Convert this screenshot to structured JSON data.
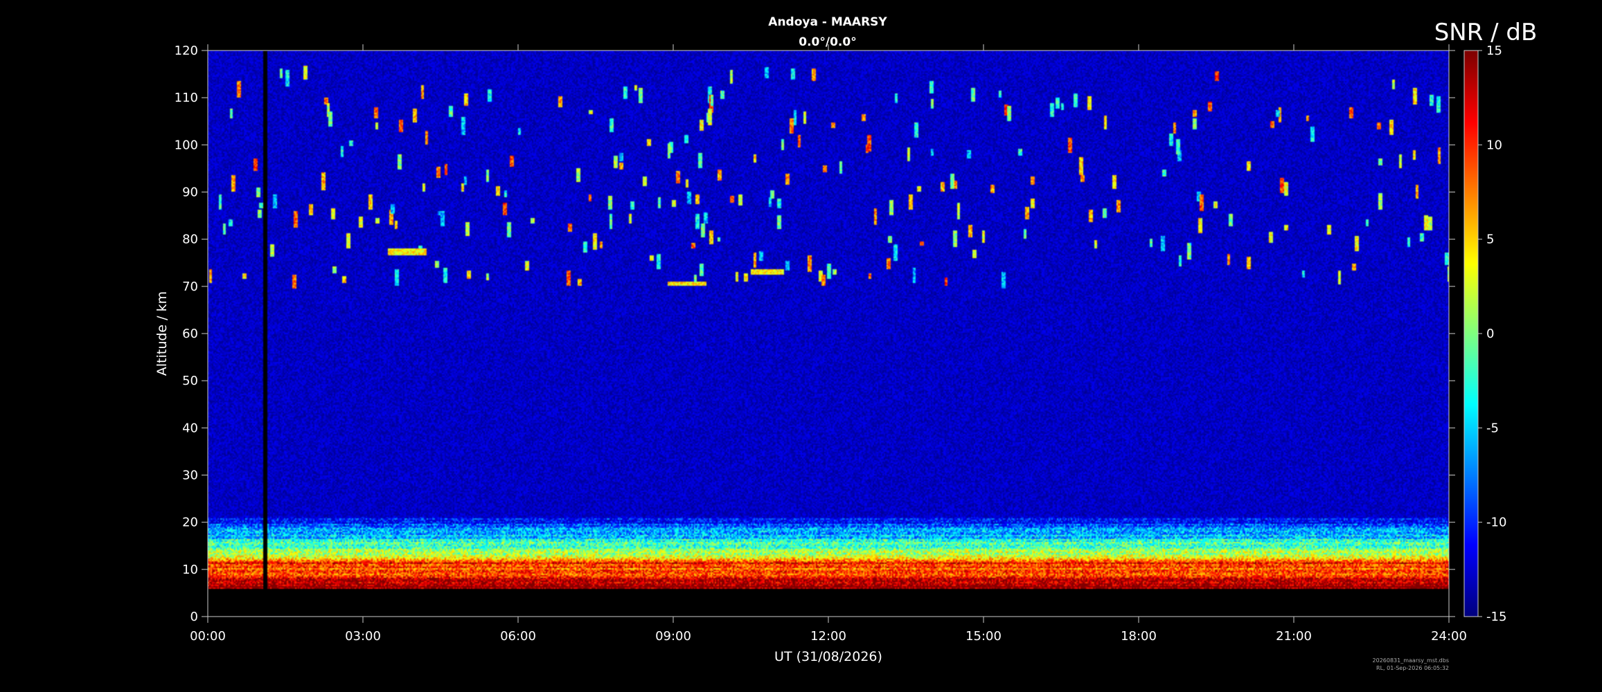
{
  "chart_data": {
    "type": "heatmap",
    "title": "Andoya - MAARSY",
    "subtitle": "0.0°/0.0°",
    "xlabel": "UT (31/08/2026)",
    "ylabel": "Altitude / km",
    "xlim": [
      0,
      24
    ],
    "ylim": [
      0,
      120
    ],
    "x_ticks": [
      {
        "value": 0,
        "label": "00:00"
      },
      {
        "value": 3,
        "label": "03:00"
      },
      {
        "value": 6,
        "label": "06:00"
      },
      {
        "value": 9,
        "label": "09:00"
      },
      {
        "value": 12,
        "label": "12:00"
      },
      {
        "value": 15,
        "label": "15:00"
      },
      {
        "value": 18,
        "label": "18:00"
      },
      {
        "value": 21,
        "label": "21:00"
      },
      {
        "value": 24,
        "label": "24:00"
      }
    ],
    "y_ticks": [
      {
        "value": 0,
        "label": "0"
      },
      {
        "value": 10,
        "label": "10"
      },
      {
        "value": 20,
        "label": "20"
      },
      {
        "value": 30,
        "label": "30"
      },
      {
        "value": 40,
        "label": "40"
      },
      {
        "value": 50,
        "label": "50"
      },
      {
        "value": 60,
        "label": "60"
      },
      {
        "value": 70,
        "label": "70"
      },
      {
        "value": 80,
        "label": "80"
      },
      {
        "value": 90,
        "label": "90"
      },
      {
        "value": 100,
        "label": "100"
      },
      {
        "value": 110,
        "label": "110"
      },
      {
        "value": 120,
        "label": "120"
      }
    ],
    "colorbar": {
      "title": "SNR / dB",
      "min": -15,
      "max": 15,
      "colormap": "jet",
      "ticks": [
        {
          "value": 15,
          "label": "15"
        },
        {
          "value": 10,
          "label": "10"
        },
        {
          "value": 5,
          "label": "5"
        },
        {
          "value": 0,
          "label": "0"
        },
        {
          "value": -5,
          "label": "-5"
        },
        {
          "value": -10,
          "label": "-10"
        },
        {
          "value": -15,
          "label": "-15"
        }
      ]
    },
    "data_altitude_range": [
      6,
      120
    ],
    "data_gap": {
      "time_start": 1.08,
      "time_end": 1.16
    },
    "tropospheric_layer": {
      "altitude_range": [
        6,
        20
      ]
    },
    "background_snr": -13,
    "echo_regions": [
      {
        "time_range": [
          0,
          24
        ],
        "altitude_range": [
          70,
          115
        ],
        "type": "sporadic-meteor-echoes"
      },
      {
        "time_range": [
          3.5,
          4.2
        ],
        "altitude_range": [
          77,
          78
        ],
        "type": "layer-echo"
      },
      {
        "time_range": [
          8.9,
          9.6
        ],
        "altitude_range": [
          70.5,
          71
        ],
        "type": "layer-echo"
      },
      {
        "time_range": [
          10.5,
          11.1
        ],
        "altitude_range": [
          73,
          73.5
        ],
        "type": "layer-echo"
      }
    ]
  },
  "footer": {
    "filename": "20260831_maarsy_mst.dbs",
    "stamp": "RL, 01-Sep-2026 06:05:32"
  },
  "colors": {
    "background": "#000000",
    "axis": "#ffffff",
    "noise_floor": "#0a1e9c"
  }
}
